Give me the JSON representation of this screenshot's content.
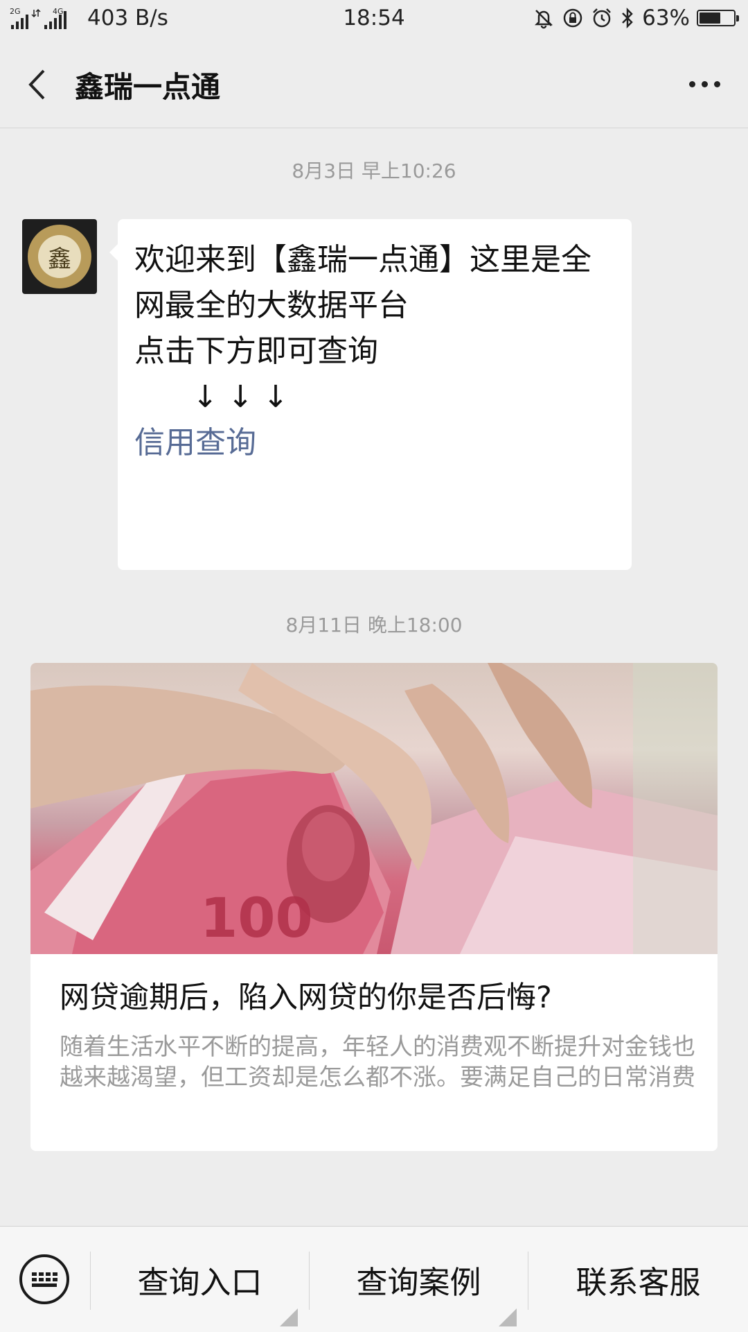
{
  "status_bar": {
    "net_label_1": "2G",
    "net_label_2": "4G",
    "speed": "403 B/s",
    "time": "18:54",
    "battery_text": "63%",
    "battery_level": 0.63,
    "icons": [
      "signal-icon",
      "mute-bell-icon",
      "rotation-lock-icon",
      "alarm-icon",
      "bluetooth-icon",
      "battery-icon"
    ]
  },
  "nav": {
    "title": "鑫瑞一点通",
    "back_icon": "back-chevron-icon",
    "more_icon": "more-dots-icon"
  },
  "messages": [
    {
      "timestamp": "8月3日 早上10:26",
      "avatar_glyph": "鑫",
      "lines": [
        "欢迎来到【鑫瑞一点通】这里是全",
        "网最全的大数据平台",
        "",
        "点击下方即可查询",
        "      ↓ ↓ ↓",
        ""
      ],
      "link": "信用查询"
    },
    {
      "timestamp": "8月11日 晚上18:00",
      "article": {
        "title": "网贷逾期后，陷入网贷的你是否后悔?",
        "description": "随着生活水平不断的提高，年轻人的消费观不断提升对金钱也越来越渴望，但工资却是怎么都不涨。要满足自己的日常消费"
      }
    }
  ],
  "bottom_menu": {
    "keyboard_icon": "keyboard-icon",
    "items": [
      {
        "label": "查询入口"
      },
      {
        "label": "查询案例"
      },
      {
        "label": "联系客服"
      }
    ]
  },
  "colors": {
    "background": "#ededed",
    "link": "#576b95",
    "bubble": "#ffffff",
    "muted_text": "#9a9a9a"
  }
}
